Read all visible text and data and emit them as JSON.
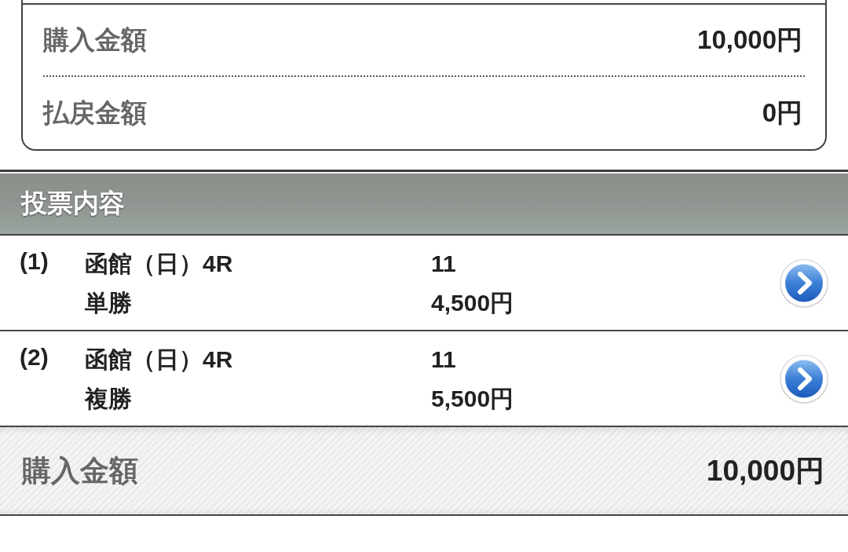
{
  "summary": [
    {
      "label": "購入金額",
      "value": "10,000円"
    },
    {
      "label": "払戻金額",
      "value": "0円"
    }
  ],
  "section": {
    "title": "投票内容"
  },
  "bets": [
    {
      "number": "(1)",
      "race": "函館（日）4R",
      "bet_type": "単勝",
      "selection": "11",
      "amount": "4,500円"
    },
    {
      "number": "(2)",
      "race": "函館（日）4R",
      "bet_type": "複勝",
      "selection": "11",
      "amount": "5,500円"
    }
  ],
  "total": {
    "label": "購入金額",
    "value": "10,000円"
  }
}
